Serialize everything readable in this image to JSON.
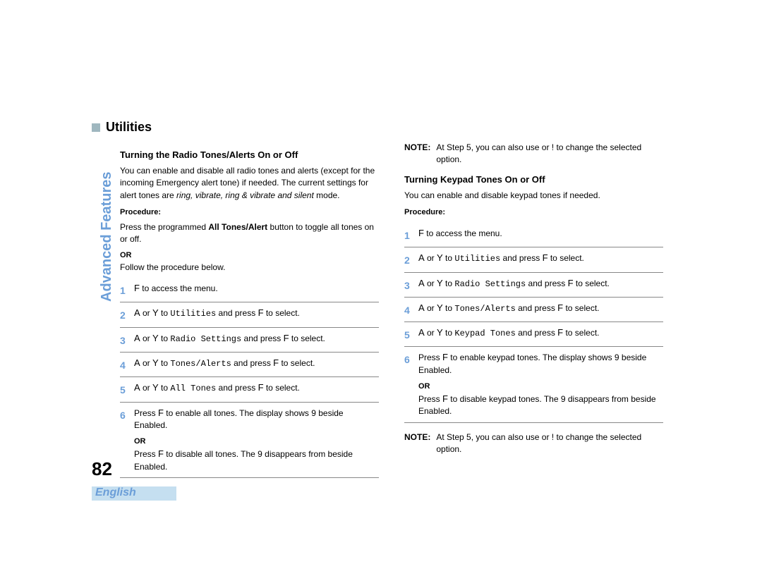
{
  "side_tab": "Advanced Features",
  "page_number": "82",
  "language": "English",
  "heading": "Utilities",
  "left": {
    "subhead": "Turning the Radio Tones/Alerts On or Off",
    "p1_a": "You can enable and disable all radio tones and alerts (except for the incoming Emergency alert tone) if needed. The current settings for alert tones are ",
    "p1_em": "ring, vibrate, ring & vibrate and silent",
    "p1_b": " mode.",
    "proc_label": "Procedure:",
    "p2_a": "Press the programmed ",
    "p2_b": "All Tones/Alert",
    "p2_c": " button to toggle all tones on or off.",
    "or": "OR",
    "p3": "Follow the procedure below.",
    "steps": [
      {
        "n": "1",
        "pre": "",
        "post": " to access the menu.",
        "keyA": "F"
      },
      {
        "n": "2",
        "keyA": "A",
        "mid": " or ",
        "keyB": "Y",
        "to": " to ",
        "menu": "Utilities",
        "press": " and press ",
        "keyC": "F",
        "sel": " to select."
      },
      {
        "n": "3",
        "keyA": "A",
        "mid": " or ",
        "keyB": "Y",
        "to": " to ",
        "menu": "Radio Settings",
        "press": " and press ",
        "keyC": "F",
        "sel": " to select."
      },
      {
        "n": "4",
        "keyA": "A",
        "mid": " or ",
        "keyB": "Y",
        "to": " to ",
        "menu": "Tones/Alerts",
        "press": " and press ",
        "keyC": "F",
        "sel": " to select."
      },
      {
        "n": "5",
        "keyA": "A",
        "mid": " or ",
        "keyB": "Y",
        "to": " to ",
        "menu": "All Tones",
        "press": " and press ",
        "keyC": "F",
        "sel": " to select."
      },
      {
        "n": "6",
        "line1_a": "Press ",
        "line1_key": "F",
        "line1_b": " to enable all tones. The display shows  9 beside Enabled.",
        "or": "OR",
        "line2_a": "Press ",
        "line2_key": "F",
        "line2_b": " to disable all tones. The  9 disappears from beside Enabled."
      }
    ]
  },
  "right": {
    "note1_lbl": "NOTE:",
    "note1_txt": "At Step 5, you can also use      or   ! to change the selected option.",
    "subhead": "Turning Keypad Tones On or Off",
    "p1": "You can enable and disable keypad tones if needed.",
    "proc_label": "Procedure:",
    "steps": [
      {
        "n": "1",
        "keyA": "F",
        "post": " to access the menu."
      },
      {
        "n": "2",
        "keyA": "A",
        "mid": " or ",
        "keyB": "Y",
        "to": " to ",
        "menu": "Utilities",
        "press": " and press ",
        "keyC": "F",
        "sel": " to select."
      },
      {
        "n": "3",
        "keyA": "A",
        "mid": " or ",
        "keyB": "Y",
        "to": " to ",
        "menu": "Radio Settings",
        "press": " and press ",
        "keyC": "F",
        "sel": " to select."
      },
      {
        "n": "4",
        "keyA": "A",
        "mid": " or ",
        "keyB": "Y",
        "to": " to ",
        "menu": "Tones/Alerts",
        "press": " and press ",
        "keyC": "F",
        "sel": " to select."
      },
      {
        "n": "5",
        "keyA": "A",
        "mid": " or ",
        "keyB": "Y",
        "to": " to ",
        "menu": "Keypad Tones",
        "press": " and press ",
        "keyC": "F",
        "sel": " to select."
      },
      {
        "n": "6",
        "line1_a": "Press ",
        "line1_key": "F",
        "line1_b": " to enable keypad tones. The display shows  9 beside Enabled.",
        "or": "OR",
        "line2_a": "Press ",
        "line2_key": "F",
        "line2_b": " to disable keypad tones. The  9 disappears from beside Enabled."
      }
    ],
    "note2_lbl": "NOTE:",
    "note2_txt": "At Step 5, you can also use      or   ! to change the selected option."
  }
}
